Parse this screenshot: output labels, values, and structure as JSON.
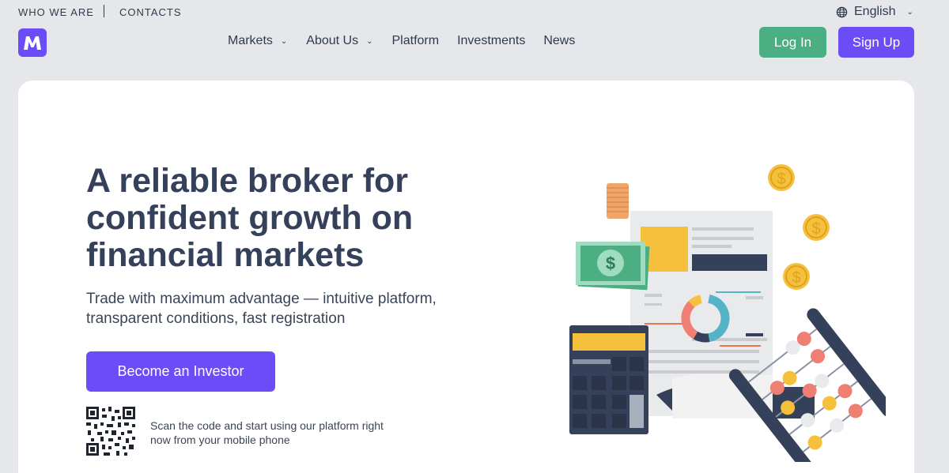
{
  "topbar": {
    "who_we_are": "WHO WE ARE",
    "contacts": "CONTACTS",
    "language": "English",
    "language_icon": "globe-icon"
  },
  "header": {
    "logo_letter": "M",
    "nav": [
      "Markets",
      "About Us",
      "Platform",
      "Investments",
      "News"
    ],
    "login_label": "Log In",
    "signup_label": "Sign Up"
  },
  "hero": {
    "headline": "A reliable broker for confident growth on financial markets",
    "subtext": "Trade with maximum advantage — intuitive platform, transparent conditions, fast registration",
    "cta_label": "Become an Investor",
    "qr_text": "Scan the code and start using our platform right now from your mobile phone",
    "illustration": {
      "dollar_sign": "$",
      "icon": "finance-illustration"
    }
  },
  "colors": {
    "brand": "#6c4cf6",
    "login": "#4caf83",
    "background": "#e6e7ea",
    "text": "#35405a"
  }
}
